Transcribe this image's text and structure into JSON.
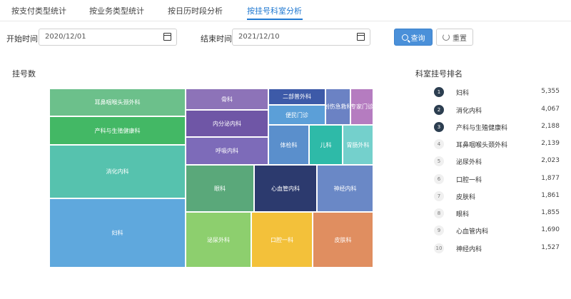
{
  "tabs": [
    {
      "label": "按支付类型统计",
      "active": false
    },
    {
      "label": "按业务类型统计",
      "active": false
    },
    {
      "label": "按日历时段分析",
      "active": false
    },
    {
      "label": "按挂号科室分析",
      "active": true
    }
  ],
  "filters": {
    "start_label": "开始时间:",
    "start_value": "2020/12/01",
    "end_label": "结束时间:",
    "end_value": "2021/12/10",
    "query_label": "查询",
    "reset_label": "重置"
  },
  "colors": {
    "accent": "#1f78d1",
    "query_bg": "#4a90d9",
    "rank_top": "#2c3e50"
  },
  "treemap": {
    "title": "挂号数",
    "cells": [
      {
        "label": "耳鼻咽喉头颈外科",
        "color": "#6cc08b"
      },
      {
        "label": "产科与生殖健康科",
        "color": "#43b865"
      },
      {
        "label": "消化内科",
        "color": "#56c2ae"
      },
      {
        "label": "妇科",
        "color": "#5fa8dd"
      },
      {
        "label": "骨科",
        "color": "#8d73b8"
      },
      {
        "label": "内分泌内科",
        "color": "#6f56a6"
      },
      {
        "label": "呼吸内科",
        "color": "#7d6bb9"
      },
      {
        "label": "眼科",
        "color": "#5aa87a"
      },
      {
        "label": "心血管内科",
        "color": "#2c3a6e"
      },
      {
        "label": "神经内科",
        "color": "#6a88c6"
      },
      {
        "label": "泌尿外科",
        "color": "#8dcf6e"
      },
      {
        "label": "口腔一科",
        "color": "#f3c13a"
      },
      {
        "label": "皮肤科",
        "color": "#e08e60"
      },
      {
        "label": "二部普外科",
        "color": "#3d5aa8"
      },
      {
        "label": "便民门诊",
        "color": "#5b9fd8"
      },
      {
        "label": "创伤急救科",
        "color": "#6b82c4"
      },
      {
        "label": "专家门诊",
        "color": "#b57cc0"
      },
      {
        "label": "体检科",
        "color": "#5a8fcc"
      },
      {
        "label": "儿科",
        "color": "#2ebaa8"
      },
      {
        "label": "胃肠外科",
        "color": "#74d0cc"
      }
    ]
  },
  "ranking": {
    "title": "科室挂号排名",
    "items": [
      {
        "rank": "1",
        "name": "妇科",
        "value": "5,355"
      },
      {
        "rank": "2",
        "name": "消化内科",
        "value": "4,067"
      },
      {
        "rank": "3",
        "name": "产科与生殖健康科",
        "value": "2,188"
      },
      {
        "rank": "4",
        "name": "耳鼻咽喉头颈外科",
        "value": "2,139"
      },
      {
        "rank": "5",
        "name": "泌尿外科",
        "value": "2,023"
      },
      {
        "rank": "6",
        "name": "口腔一科",
        "value": "1,877"
      },
      {
        "rank": "7",
        "name": "皮肤科",
        "value": "1,861"
      },
      {
        "rank": "8",
        "name": "眼科",
        "value": "1,855"
      },
      {
        "rank": "9",
        "name": "心血管内科",
        "value": "1,690"
      },
      {
        "rank": "10",
        "name": "神经内科",
        "value": "1,527"
      }
    ]
  }
}
